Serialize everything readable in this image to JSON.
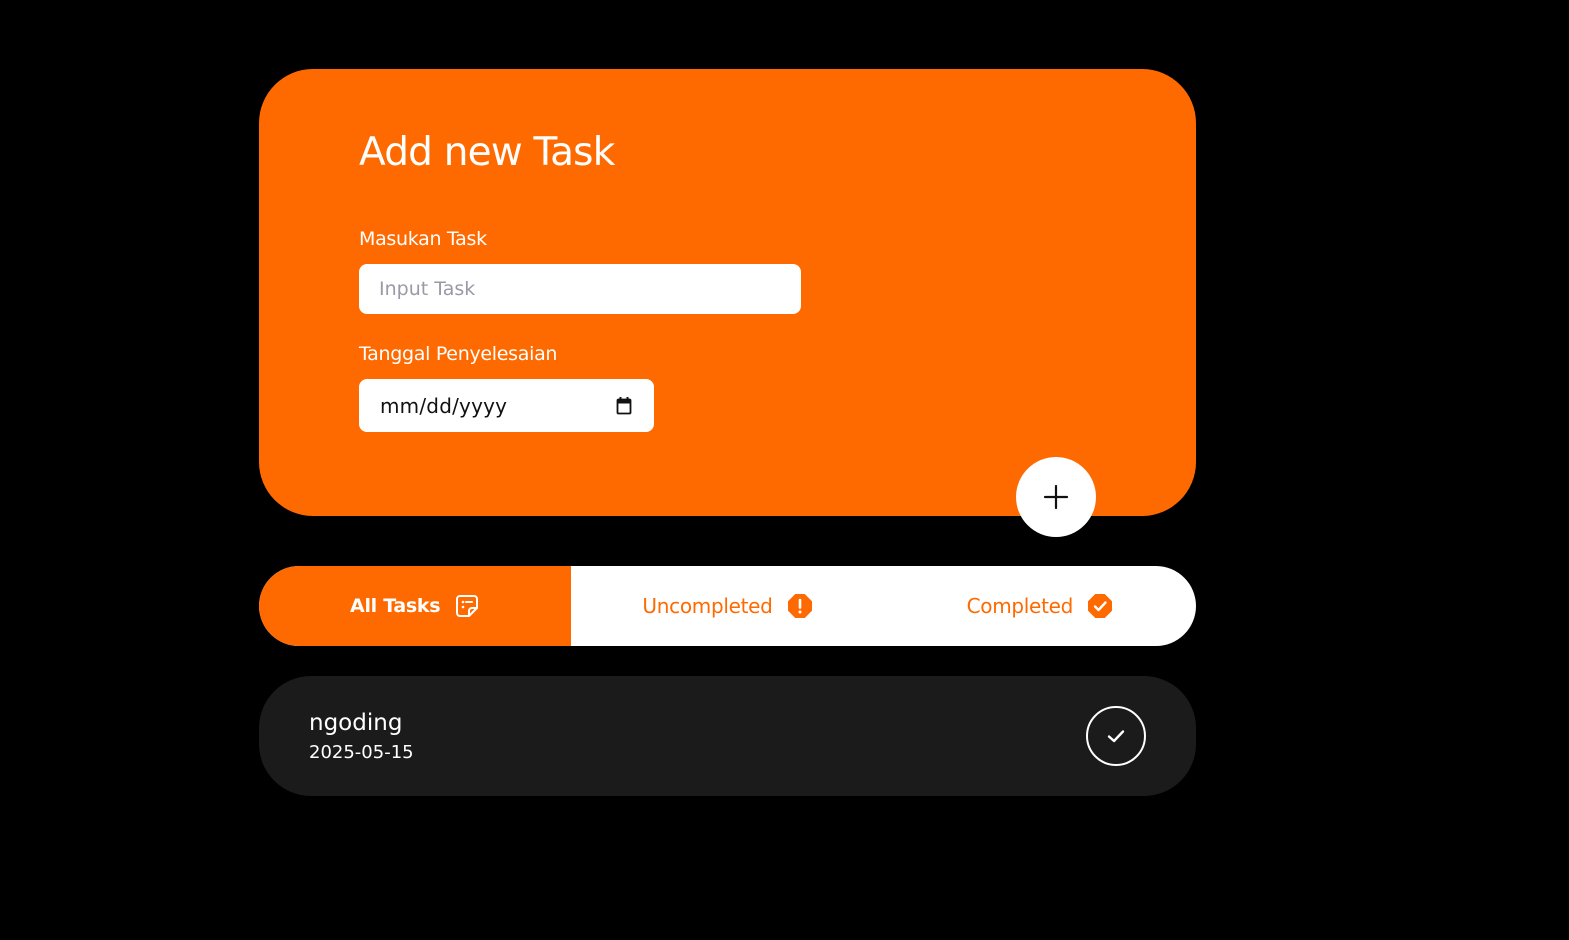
{
  "add_task": {
    "title": "Add new Task",
    "task_label": "Masukan Task",
    "task_placeholder": "Input Task",
    "task_value": "",
    "date_label": "Tanggal Penyelesaian",
    "date_placeholder": "mm/dd/yyyy",
    "add_button_icon": "plus-icon"
  },
  "tabs": [
    {
      "label": "All Tasks",
      "icon": "sticky-note-icon",
      "active": true
    },
    {
      "label": "Uncompleted",
      "icon": "alert-badge-icon",
      "active": false
    },
    {
      "label": "Completed",
      "icon": "check-badge-icon",
      "active": false
    }
  ],
  "tasks": [
    {
      "name": "ngoding",
      "date": "2025-05-15",
      "action_icon": "check-icon"
    }
  ],
  "colors": {
    "accent": "#FF6A00",
    "background": "#000000",
    "task_card": "#1B1B1B",
    "surface": "#FFFFFF"
  }
}
